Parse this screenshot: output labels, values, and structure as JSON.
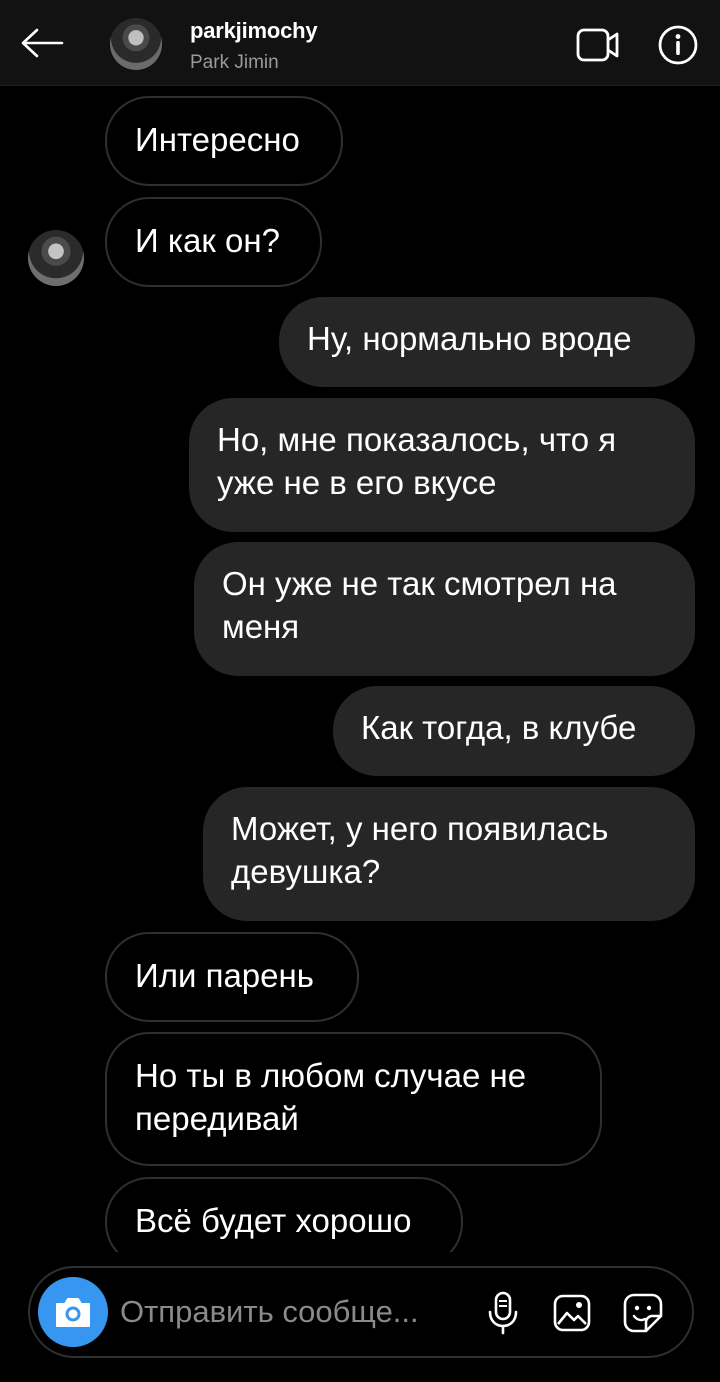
{
  "header": {
    "username": "parkjimochy",
    "display_name": "Park Jimin"
  },
  "messages": [
    {
      "side": "in",
      "text": "Интересно"
    },
    {
      "side": "in",
      "text": "И как он?"
    },
    {
      "side": "out",
      "text": "Ну, нормально вроде"
    },
    {
      "side": "out",
      "text": "Но, мне показалось, что я уже не в его вкусе"
    },
    {
      "side": "out",
      "text": "Он уже не так смотрел на меня"
    },
    {
      "side": "out",
      "text": "Как тогда, в клубе"
    },
    {
      "side": "out",
      "text": "Может, у него появилась девушка?"
    },
    {
      "side": "in",
      "text": "Или парень"
    },
    {
      "side": "in",
      "text": "Но ты в любом случае не передивай"
    },
    {
      "side": "in",
      "text": "Всё будет хорошо"
    }
  ],
  "composer": {
    "placeholder": "Отправить сообще..."
  },
  "icons": {
    "back": "arrow-left-icon",
    "video": "video-camera-icon",
    "info": "info-icon",
    "camera": "camera-icon",
    "mic": "microphone-icon",
    "gallery": "image-icon",
    "sticker": "sticker-icon"
  },
  "colors": {
    "accent": "#3797f0",
    "outgoing_bubble": "#262626",
    "incoming_border": "#2f2f2f",
    "background": "#000000"
  }
}
